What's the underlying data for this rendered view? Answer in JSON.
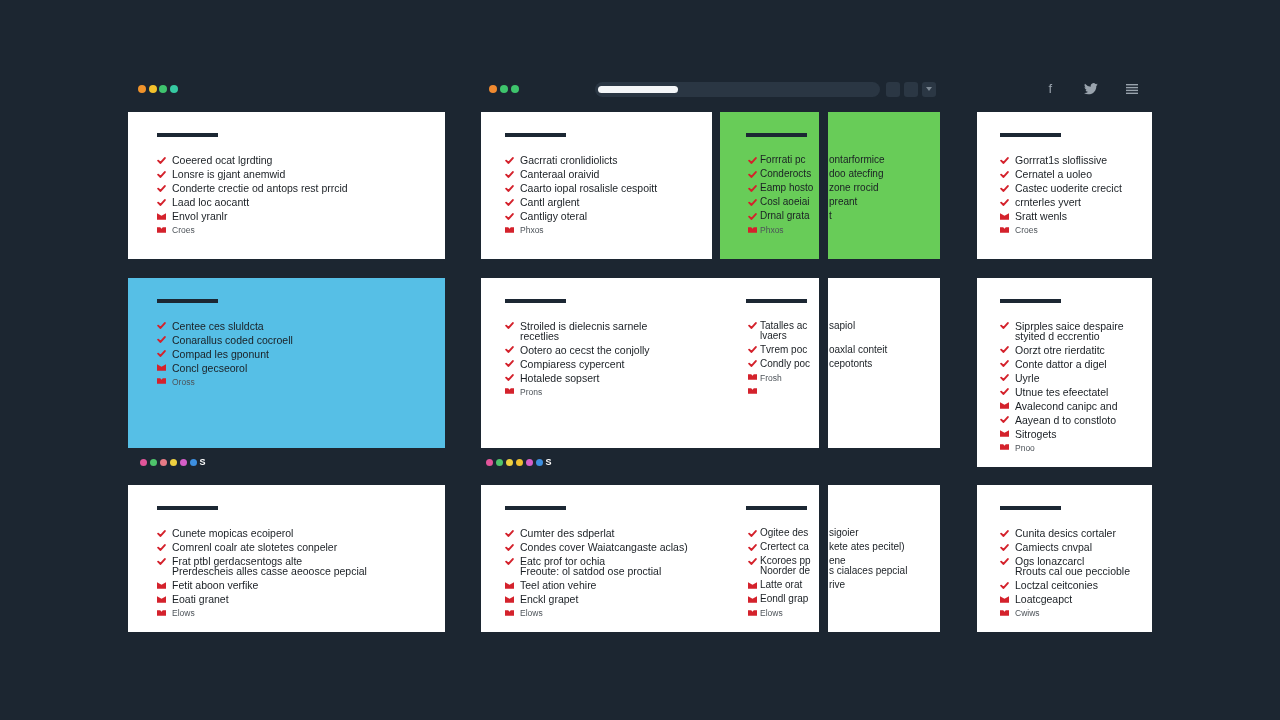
{
  "columns": [
    {
      "header": {
        "dots": [
          {
            "color": "#f0932b"
          },
          {
            "color": "#f3c12c"
          },
          {
            "color": "#3fc46e"
          },
          {
            "color": "#36c9a2"
          }
        ]
      },
      "blocks": [
        {
          "kind": "cards",
          "cards": [
            {
              "kind": "plain",
              "color": "#ffffff",
              "lists": [
                {
                  "items": [
                    {
                      "kind": "check",
                      "text": "Coeered ocat lgrdting"
                    },
                    {
                      "kind": "check",
                      "text": "Lonsre is gjant anemwid"
                    },
                    {
                      "kind": "check",
                      "text": "Conderte crectie od antops rest prrcid"
                    },
                    {
                      "kind": "check",
                      "text": "Laad loc aocantt"
                    },
                    {
                      "kind": "mark",
                      "text": "Envol yranlr"
                    },
                    {
                      "kind": "note",
                      "text": "Croes"
                    }
                  ]
                }
              ]
            }
          ]
        },
        {
          "kind": "cards",
          "cards": [
            {
              "kind": "plain",
              "color": "#56bfe6",
              "lists": [
                {
                  "items": [
                    {
                      "kind": "check",
                      "text": "Centee ces sluldcta"
                    },
                    {
                      "kind": "check",
                      "text": "Conarallus coded cocroell"
                    },
                    {
                      "kind": "check",
                      "text": "Compad les gponunt"
                    },
                    {
                      "kind": "mark",
                      "text": "Concl gecseorol"
                    },
                    {
                      "kind": "note",
                      "text": "Oross"
                    }
                  ]
                }
              ]
            }
          ]
        },
        {
          "kind": "swatches",
          "dots": [
            {
              "color": "#e2559a"
            },
            {
              "color": "#4ec46b"
            },
            {
              "color": "#e77b86"
            },
            {
              "color": "#eed040"
            },
            {
              "color": "#d65ec8"
            },
            {
              "color": "#3d8fe0"
            }
          ],
          "label": "S"
        },
        {
          "kind": "cards",
          "cards": [
            {
              "kind": "plain",
              "color": "#ffffff",
              "lists": [
                {
                  "items": [
                    {
                      "kind": "check",
                      "text": "Cunete mopicas ecoiperol"
                    },
                    {
                      "kind": "check",
                      "text": "Comrenl coalr ate slotetes conpeler"
                    },
                    {
                      "kind": "check",
                      "text": "Frat ptbl gerdacsentogs alte\nPrerdescheis alles casse aeoosce pepcial"
                    },
                    {
                      "kind": "mark",
                      "text": "Fetit aboon verfike"
                    },
                    {
                      "kind": "mark",
                      "text": "Eoati granet"
                    },
                    {
                      "kind": "note",
                      "text": "Elows"
                    }
                  ]
                }
              ]
            }
          ]
        }
      ]
    },
    {
      "header": {
        "dots": [
          {
            "color": "#f08a30"
          },
          {
            "color": "#3ec46c"
          },
          {
            "color": "#3ec46c"
          }
        ],
        "address_bar": {
          "level": 0.28
        },
        "buttons": [
          {
            "kind": "plain"
          },
          {
            "kind": "plain"
          },
          {
            "kind": "menu"
          }
        ]
      },
      "blocks": [
        {
          "kind": "cards",
          "cards": [
            {
              "kind": "plain",
              "color": "#ffffff",
              "lists": [
                {
                  "items": [
                    {
                      "kind": "check",
                      "text": "Gacrrati cronlidiolicts"
                    },
                    {
                      "kind": "check",
                      "text": "Canteraal oraivid"
                    },
                    {
                      "kind": "check",
                      "text": "Caarto iopal rosalisle cespoitt"
                    },
                    {
                      "kind": "check",
                      "text": "Cantl arglent"
                    },
                    {
                      "kind": "check",
                      "text": "Cantligy oteral"
                    },
                    {
                      "kind": "note",
                      "text": "Phxos"
                    }
                  ]
                }
              ]
            },
            {
              "kind": "split",
              "color": "#68cc58",
              "lists": [
                {
                  "items": [
                    {
                      "kind": "check",
                      "text": "Forrrati pc",
                      "continued": "ontarformice"
                    },
                    {
                      "kind": "check",
                      "text": "Conderocts",
                      "continued": "doo atecfing"
                    },
                    {
                      "kind": "check",
                      "text": "Eamp hosto",
                      "continued": "zone rrocid"
                    },
                    {
                      "kind": "check",
                      "text": "Cosl aoeiai",
                      "continued": "preant"
                    },
                    {
                      "kind": "check",
                      "text": "Drnal grata",
                      "continued": "t"
                    },
                    {
                      "kind": "note",
                      "text": "Phxos"
                    }
                  ]
                }
              ]
            }
          ]
        },
        {
          "kind": "cards",
          "cards": [
            {
              "kind": "split",
              "color": "#ffffff",
              "lists": [
                {
                  "items": [
                    {
                      "kind": "check",
                      "text": "Stroiled is dielecnis sarnele\nrecetlies"
                    },
                    {
                      "kind": "check",
                      "text": "Ootero ao cecst the conjolly"
                    },
                    {
                      "kind": "check",
                      "text": "Compiaress cypercent"
                    },
                    {
                      "kind": "check",
                      "text": "Hotalede sopsert"
                    },
                    {
                      "kind": "note",
                      "text": "Prons"
                    }
                  ]
                },
                {
                  "items": [
                    {
                      "kind": "check",
                      "text": "Tatalles ac\nlvaers",
                      "continued": "sapiol"
                    },
                    {
                      "kind": "check",
                      "text": "Tvrem poc",
                      "continued": "oaxlal conteit"
                    },
                    {
                      "kind": "check",
                      "text": "Condly poc",
                      "continued": "cepotonts"
                    },
                    {
                      "kind": "note",
                      "text": "Frosh"
                    },
                    {
                      "kind": "note"
                    }
                  ]
                }
              ]
            }
          ]
        },
        {
          "kind": "swatches",
          "dots": [
            {
              "color": "#e2559a"
            },
            {
              "color": "#4ec46b"
            },
            {
              "color": "#eed040"
            },
            {
              "color": "#f0c030"
            },
            {
              "color": "#d65ec8"
            },
            {
              "color": "#3d8fe0"
            }
          ],
          "label": "S"
        },
        {
          "kind": "cards",
          "cards": [
            {
              "kind": "split",
              "color": "#ffffff",
              "lists": [
                {
                  "items": [
                    {
                      "kind": "check",
                      "text": "Cumter des sdperlat"
                    },
                    {
                      "kind": "check",
                      "text": "Condes cover Waiatcangaste aclas)"
                    },
                    {
                      "kind": "check",
                      "text": "Eatc prof tor ochia\nFreoute: ol satdod ose proctial"
                    },
                    {
                      "kind": "mark",
                      "text": "Teel ation vehire"
                    },
                    {
                      "kind": "mark",
                      "text": "Enckl grapet"
                    },
                    {
                      "kind": "note",
                      "text": "Elows"
                    }
                  ]
                },
                {
                  "items": [
                    {
                      "kind": "check",
                      "text": "Ogitee des",
                      "continued": "sigoier"
                    },
                    {
                      "kind": "check",
                      "text": "Crertect ca",
                      "continued": "kete ates pecitel)"
                    },
                    {
                      "kind": "check",
                      "text": "Kcoroes pp\nNoorder de",
                      "continued": "ene\ns cialaces pepcial"
                    },
                    {
                      "kind": "mark",
                      "text": "Latte orat",
                      "continued": "rive"
                    },
                    {
                      "kind": "mark",
                      "text": "Eondl grap"
                    },
                    {
                      "kind": "note",
                      "text": "Elows"
                    }
                  ]
                }
              ]
            }
          ]
        }
      ]
    },
    {
      "header": {
        "social": {
          "letter": "f"
        }
      },
      "blocks": [
        {
          "kind": "cards",
          "cards": [
            {
              "kind": "plain",
              "color": "#ffffff",
              "lists": [
                {
                  "items": [
                    {
                      "kind": "check",
                      "text": "Gorrrat1s sloflissive"
                    },
                    {
                      "kind": "check",
                      "text": "Cernatel a uoleo"
                    },
                    {
                      "kind": "check",
                      "text": "Castec uoderite crecict"
                    },
                    {
                      "kind": "check",
                      "text": "crnterles yvert"
                    },
                    {
                      "kind": "mark",
                      "text": "Sratt wenls"
                    },
                    {
                      "kind": "note",
                      "text": "Croes"
                    }
                  ]
                }
              ]
            }
          ]
        },
        {
          "kind": "cards",
          "cards": [
            {
              "kind": "plain",
              "color": "#ffffff",
              "lists": [
                {
                  "items": [
                    {
                      "kind": "check",
                      "text": "Siprples saice despaire\nstyited d eccrentio"
                    },
                    {
                      "kind": "check",
                      "text": "Oorzt otre rierdatitc"
                    },
                    {
                      "kind": "check",
                      "text": "Conte dattor a digel"
                    },
                    {
                      "kind": "check",
                      "text": "Uyrle"
                    },
                    {
                      "kind": "check",
                      "text": "Utnue tes efeectatel"
                    },
                    {
                      "kind": "mark",
                      "text": "Avalecond canipc and"
                    },
                    {
                      "kind": "check",
                      "text": "Aayean d to constloto"
                    },
                    {
                      "kind": "mark",
                      "text": "Sitrogets"
                    },
                    {
                      "kind": "note",
                      "text": "Pnoo"
                    }
                  ]
                }
              ]
            }
          ]
        },
        {
          "kind": "cards",
          "cards": [
            {
              "kind": "plain",
              "color": "#ffffff",
              "lists": [
                {
                  "items": [
                    {
                      "kind": "check",
                      "text": "Cunita desics cortaler"
                    },
                    {
                      "kind": "check",
                      "text": "Camiects cnvpal"
                    },
                    {
                      "kind": "check",
                      "text": "Ogs lonazcarcl\nRrouts cal oue peccioble"
                    },
                    {
                      "kind": "check",
                      "text": "Loctzal ceitconies"
                    },
                    {
                      "kind": "mark",
                      "text": "Loatcgeapct"
                    },
                    {
                      "kind": "note",
                      "text": "Cwiws"
                    }
                  ]
                }
              ]
            }
          ]
        }
      ]
    }
  ]
}
